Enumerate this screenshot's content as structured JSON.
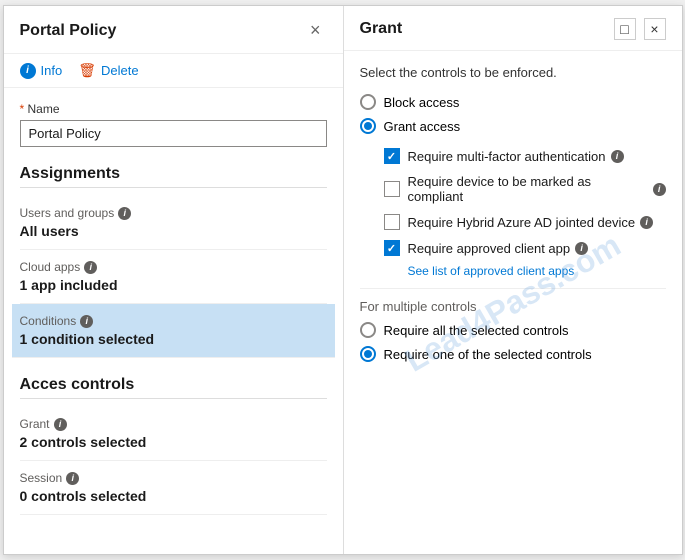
{
  "left": {
    "title": "Portal Policy",
    "toolbar": {
      "info_label": "Info",
      "delete_label": "Delete"
    },
    "name_field": {
      "label": "Name",
      "value": "Portal Policy"
    },
    "assignments_section": "Assignments",
    "users_groups": {
      "label": "Users and groups",
      "value": "All users"
    },
    "cloud_apps": {
      "label": "Cloud apps",
      "value": "1 app included"
    },
    "conditions": {
      "label": "Conditions",
      "value": "1 condition selected"
    },
    "acces_controls": "Acces controls",
    "grant": {
      "label": "Grant",
      "value": "2 controls selected"
    },
    "session": {
      "label": "Session",
      "value": "0 controls selected"
    }
  },
  "right": {
    "title": "Grant",
    "subtitle": "Select the controls to be enforced.",
    "block_access": "Block access",
    "grant_access": "Grant access",
    "checkboxes": [
      {
        "label": "Require multi-factor authentication",
        "checked": true
      },
      {
        "label": "Require device to be marked as compliant",
        "checked": false
      },
      {
        "label": "Require Hybrid Azure AD jointed device",
        "checked": false
      },
      {
        "label": "Require approved client app",
        "checked": true
      }
    ],
    "link_text": "See list of approved client apps",
    "multiple_controls_label": "For multiple controls",
    "radio_options": [
      {
        "label": "Require all the selected controls",
        "checked": false
      },
      {
        "label": "Require one of the selected controls",
        "checked": true
      }
    ]
  },
  "watermark": "Lead4Pass.com"
}
